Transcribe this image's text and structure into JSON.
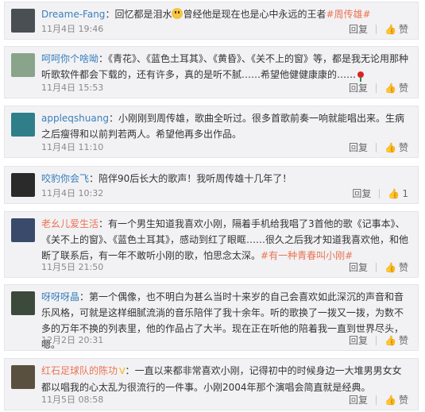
{
  "labels": {
    "reply": "回复",
    "like": "赞"
  },
  "comments": [
    {
      "user": "Dreame-Fang",
      "text_before": "回忆都是泪水",
      "text_after": "曾经他是现在也是心中永远的王者",
      "topic": "#周传雄#",
      "time": "11月4日 19:46",
      "likes": "",
      "avatar_color": "#4a4f54"
    },
    {
      "user": "呵呵你个啥呦",
      "text": "《青花》、《蓝色土耳其》、《黄昏》、《关不上的窗》等，都是我无论用那种听歌软件都会下载的，还有许多，真的是听不腻……希望他健健康康的……",
      "time": "11月4日 15:53",
      "likes": "",
      "avatar_color": "#8aa48c"
    },
    {
      "user": "appleqshuang",
      "text": "小刚刚到周传雄，歌曲全听过。很多首歌前奏一响就能唱出来。生病之后瘦得和以前判若两人。希望他再多出作品。",
      "time": "11月4日 11:10",
      "likes": "",
      "avatar_color": "#2f7f8a"
    },
    {
      "user": "咬豹你会飞",
      "text": "陪伴90后长大的歌声！我听周传雄十几年了！",
      "time": "11月4日 10:32",
      "likes": "1",
      "avatar_color": "#2a2a2a"
    },
    {
      "user": "老幺儿爱生活",
      "text": "有一个男生知道我喜欢小刚，隔着手机给我唱了3首他的歌《记事本》、《关不上的窗》、《蓝色土耳其》，感动到红了眼眶……很久之后我才知道我喜欢他，和他断了联系后，有一年不敢听小刚的歌，怕思念太深。",
      "topic": "#有一种青春叫小刚#",
      "time": "11月5日 21:50",
      "likes": "",
      "avatar_color": "#3a4a6a"
    },
    {
      "user": "呀呀呀晶",
      "text": "第一个偶像，也不明白为甚么当时十来岁的自己会喜欢如此深沉的声音和音乐风格，可就是这样细腻流淌的音乐陪伴了我十余年。听的歌换了一拨又一拨，为数不多的万年不换的列表里，他的作品占了大半。现在正在听他的陪着我一直到世界尽头，嗯。",
      "time": "12月2日 20:31",
      "likes": "",
      "avatar_color": "#3c4a3c"
    },
    {
      "user": "红石足球队的陈功",
      "text": "一直以来都非常喜欢小刚，记得初中的时候身边一大堆男男女女都以唱我的心太乱为很流行的一件事。小刚2004年那个演唱会简直就是经典。",
      "time": "11月5日 08:58",
      "likes": "",
      "avatar_color": "#5a5040"
    }
  ]
}
